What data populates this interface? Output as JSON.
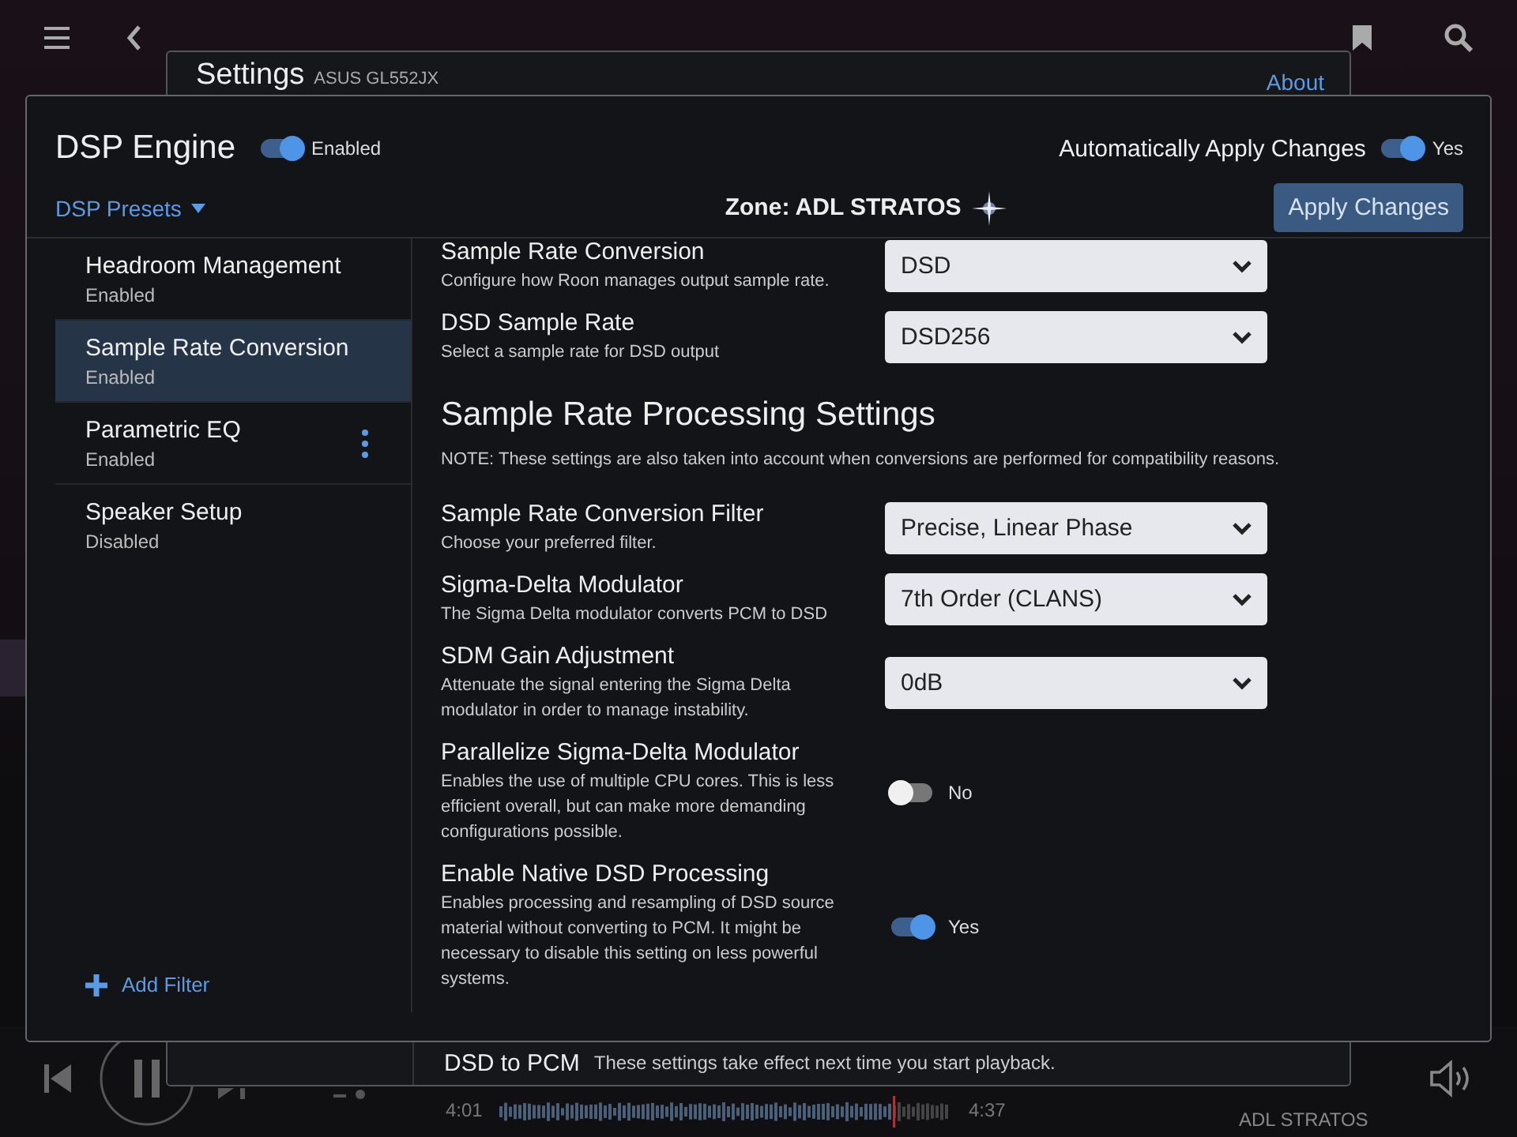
{
  "player": {
    "time_elapsed": "4:01",
    "time_total": "4:37",
    "zone": "ADL STRATOS"
  },
  "settings_window": {
    "title": "Settings",
    "device": "ASUS GL552JX",
    "about": "About",
    "footer_title": "DSD to PCM",
    "footer_note": "These settings take effect next time you start playback."
  },
  "dialog": {
    "title": "DSP Engine",
    "enabled": true,
    "enabled_label": "Enabled",
    "auto_apply_label": "Automatically Apply Changes",
    "auto_apply": true,
    "auto_apply_value": "Yes",
    "presets": "DSP Presets",
    "zone": "Zone: ADL STRATOS",
    "apply_button": "Apply Changes",
    "add_filter": "Add Filter"
  },
  "filters": [
    {
      "name": "Headroom Management",
      "status": "Enabled",
      "selected": false,
      "has_menu": false
    },
    {
      "name": "Sample Rate Conversion",
      "status": "Enabled",
      "selected": true,
      "has_menu": false
    },
    {
      "name": "Parametric EQ",
      "status": "Enabled",
      "selected": false,
      "has_menu": true
    },
    {
      "name": "Speaker Setup",
      "status": "Disabled",
      "selected": false,
      "has_menu": false
    }
  ],
  "settings": [
    {
      "kind": "select",
      "label": "Sample Rate Conversion",
      "description": "Configure how Roon manages output sample rate.",
      "value": "DSD"
    },
    {
      "kind": "select",
      "label": "DSD Sample Rate",
      "description": "Select a sample rate for DSD output",
      "value": "DSD256"
    },
    {
      "kind": "heading",
      "label": "Sample Rate Processing Settings"
    },
    {
      "kind": "note",
      "label": "NOTE: These settings are also taken into account when conversions are performed for compatibility reasons."
    },
    {
      "kind": "select",
      "label": "Sample Rate Conversion Filter",
      "description": "Choose your preferred filter.",
      "value": "Precise, Linear Phase"
    },
    {
      "kind": "select",
      "label": "Sigma-Delta Modulator",
      "description": "The Sigma Delta modulator converts PCM to DSD",
      "value": "7th Order (CLANS)"
    },
    {
      "kind": "select",
      "label": "SDM Gain Adjustment",
      "description": "Attenuate the signal entering the Sigma Delta modulator in order to manage instability.",
      "value": "0dB"
    },
    {
      "kind": "toggle",
      "label": "Parallelize Sigma-Delta Modulator",
      "description": "Enables the use of multiple CPU cores. This is less efficient overall, but can make more demanding configurations possible.",
      "on": false,
      "value": "No"
    },
    {
      "kind": "toggle",
      "label": "Enable Native DSD Processing",
      "description": "Enables processing and resampling of DSD source material without converting to PCM. It might be necessary to disable this setting on less powerful systems.",
      "on": true,
      "value": "Yes"
    }
  ]
}
